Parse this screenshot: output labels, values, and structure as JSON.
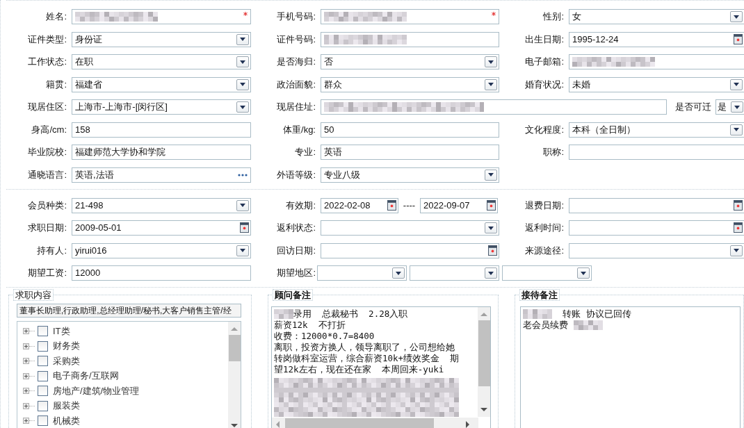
{
  "sections": [
    {
      "rows": [
        [
          {
            "label": "姓名:",
            "kind": "text",
            "redacted": true,
            "required": true
          },
          {
            "label": "手机号码:",
            "kind": "text",
            "redacted": true,
            "required": true
          },
          {
            "label": "性别:",
            "kind": "select",
            "value": "女"
          }
        ],
        [
          {
            "label": "证件类型:",
            "kind": "select",
            "value": "身份证"
          },
          {
            "label": "证件号码:",
            "kind": "text",
            "redacted": true
          },
          {
            "label": "出生日期:",
            "kind": "date",
            "value": "1995-12-24"
          }
        ],
        [
          {
            "label": "工作状态:",
            "kind": "select",
            "value": "在职"
          },
          {
            "label": "是否海归:",
            "kind": "select",
            "value": "否"
          },
          {
            "label": "电子邮箱:",
            "kind": "text",
            "redacted": true
          }
        ],
        [
          {
            "label": "籍贯:",
            "kind": "select",
            "value": "福建省"
          },
          {
            "label": "政治面貌:",
            "kind": "select",
            "value": "群众"
          },
          {
            "label": "婚育状况:",
            "kind": "select",
            "value": "未婚"
          }
        ],
        [
          {
            "label": "现居住区:",
            "kind": "select",
            "value": "上海市-上海市-[闵行区]"
          },
          {
            "label": "现居住址:",
            "kind": "text",
            "redacted": true,
            "wide": true,
            "extra": {
              "label": "是否可迁",
              "value": "是"
            }
          }
        ],
        [
          {
            "label": "身高/cm:",
            "kind": "text",
            "value": "158"
          },
          {
            "label": "体重/kg:",
            "kind": "text",
            "value": "50"
          },
          {
            "label": "文化程度:",
            "kind": "select",
            "value": "本科（全日制）"
          }
        ],
        [
          {
            "label": "毕业院校:",
            "kind": "text",
            "value": "福建师范大学协和学院"
          },
          {
            "label": "专业:",
            "kind": "text",
            "value": "英语"
          },
          {
            "label": "职称:",
            "kind": "text"
          }
        ],
        [
          {
            "label": "通晓语言:",
            "kind": "lookup",
            "value": "英语,法语"
          },
          {
            "label": "外语等级:",
            "kind": "select",
            "value": "专业八级"
          }
        ]
      ]
    },
    {
      "rows": [
        [
          {
            "label": "会员种类:",
            "kind": "select",
            "value": "21-498"
          },
          {
            "label": "有效期:",
            "kind": "range",
            "values": [
              "2022-02-08",
              "2022-09-07"
            ],
            "separator": "----"
          },
          {
            "label": "退费日期:",
            "kind": "date"
          }
        ],
        [
          {
            "label": "求职日期:",
            "kind": "date",
            "value": "2009-05-01"
          },
          {
            "label": "返利状态:",
            "kind": "select"
          },
          {
            "label": "返利时间:",
            "kind": "date"
          }
        ],
        [
          {
            "label": "持有人:",
            "kind": "select",
            "value": "yirui016"
          },
          {
            "label": "回访日期:",
            "kind": "date"
          },
          {
            "label": "来源途径:",
            "kind": "select"
          }
        ],
        [
          {
            "label": "期望工资:",
            "kind": "text",
            "value": "12000"
          },
          {
            "label": "期望地区:",
            "kind": "region"
          }
        ]
      ]
    }
  ],
  "job_intent": {
    "title": "求职内容",
    "value": "董事长助理,行政助理,总经理助理/秘书,大客户销售主管/经",
    "tree": [
      {
        "label": "IT类",
        "expanded": false,
        "checked": false
      },
      {
        "label": "财务类",
        "expanded": false,
        "checked": false
      },
      {
        "label": "采购类",
        "expanded": false,
        "checked": false
      },
      {
        "label": "电子商务/互联网",
        "expanded": false,
        "checked": false
      },
      {
        "label": "房地产/建筑/物业管理",
        "expanded": false,
        "checked": false
      },
      {
        "label": "服装类",
        "expanded": false,
        "checked": false
      },
      {
        "label": "机械类",
        "expanded": false,
        "checked": false
      }
    ]
  },
  "consultant_notes": {
    "title": "顾问备注",
    "blurred_tail": true,
    "lines": [
      {
        "text": "录用  总裁秘书  2.28入职",
        "blurred_prefix": true
      },
      {
        "text": "薪资12k  不打折"
      },
      {
        "text": "收费：12000*0.7=8400"
      },
      {
        "text": "离职，投资方换人，领导离职了，公司想给她"
      },
      {
        "text": "转岗做科室运营，综合薪资10k+绩效奖金  期"
      },
      {
        "text": "望12k左右，现在还在家  本周回来-yuki"
      }
    ]
  },
  "reception_notes": {
    "title": "接待备注",
    "lines": [
      {
        "text": "  转账 协议已回传",
        "blurred_prefix": true
      },
      {
        "text": "老会员续费 ",
        "blurred_suffix": true
      }
    ]
  }
}
